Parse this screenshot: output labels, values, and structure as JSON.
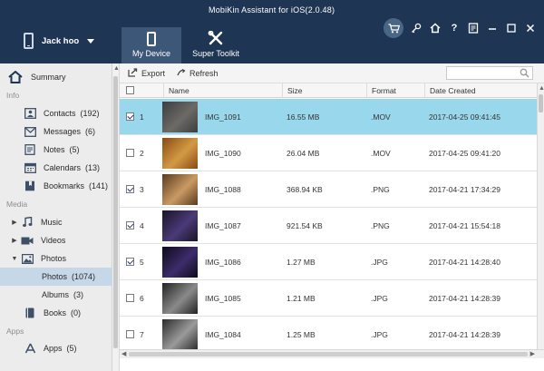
{
  "window": {
    "title": "MobiKin Assistant for iOS(2.0.48)",
    "device_name": "Jack hoo",
    "controls": [
      "cart-icon",
      "key-icon",
      "home-icon",
      "help-icon",
      "feedback-icon",
      "minimize-icon",
      "maximize-icon",
      "close-icon"
    ]
  },
  "tabs": [
    {
      "label": "My Device",
      "icon": "phone-icon",
      "active": true
    },
    {
      "label": "Super Toolkit",
      "icon": "tools-icon",
      "active": false
    }
  ],
  "sidebar": {
    "summary": {
      "label": "Summary",
      "icon": "home-icon"
    },
    "info_section": "Info",
    "info_items": [
      {
        "label": "Contacts",
        "count": "(192)",
        "icon": "contacts-icon"
      },
      {
        "label": "Messages",
        "count": "(6)",
        "icon": "messages-icon"
      },
      {
        "label": "Notes",
        "count": "(5)",
        "icon": "notes-icon"
      },
      {
        "label": "Calendars",
        "count": "(13)",
        "icon": "calendar-icon"
      },
      {
        "label": "Bookmarks",
        "count": "(141)",
        "icon": "bookmarks-icon"
      }
    ],
    "media_section": "Media",
    "media_items": [
      {
        "label": "Music",
        "icon": "music-icon",
        "expanded": false
      },
      {
        "label": "Videos",
        "icon": "video-icon",
        "expanded": false
      },
      {
        "label": "Photos",
        "icon": "photos-icon",
        "expanded": true
      }
    ],
    "photo_subitems": [
      {
        "label": "Photos",
        "count": "(1074)",
        "selected": true
      },
      {
        "label": "Albums",
        "count": "(3)",
        "selected": false
      }
    ],
    "books": {
      "label": "Books",
      "count": "(0)",
      "icon": "books-icon"
    },
    "apps_section": "Apps",
    "apps": {
      "label": "Apps",
      "count": "(5)",
      "icon": "apps-icon"
    }
  },
  "toolbar": {
    "export_label": "Export",
    "refresh_label": "Refresh",
    "search_placeholder": ""
  },
  "table": {
    "columns": [
      "Name",
      "Size",
      "Format",
      "Date Created"
    ],
    "rows": [
      {
        "index": "1",
        "checked": true,
        "selected": true,
        "name": "IMG_1091",
        "size": "16.55 MB",
        "format": ".MOV",
        "date": "2017-04-25 09:41:45",
        "thumb": [
          "#3a3d40",
          "#6d6a66"
        ]
      },
      {
        "index": "2",
        "checked": false,
        "selected": false,
        "name": "IMG_1090",
        "size": "26.04 MB",
        "format": ".MOV",
        "date": "2017-04-25 09:41:20",
        "thumb": [
          "#8a4a12",
          "#d39a45"
        ]
      },
      {
        "index": "3",
        "checked": true,
        "selected": false,
        "name": "IMG_1088",
        "size": "368.94 KB",
        "format": ".PNG",
        "date": "2017-04-21 17:34:29",
        "thumb": [
          "#5a3a20",
          "#c99a63"
        ]
      },
      {
        "index": "4",
        "checked": true,
        "selected": false,
        "name": "IMG_1087",
        "size": "921.54 KB",
        "format": ".PNG",
        "date": "2017-04-21 15:54:18",
        "thumb": [
          "#1a1426",
          "#4a3a78"
        ]
      },
      {
        "index": "5",
        "checked": true,
        "selected": false,
        "name": "IMG_1086",
        "size": "1.27 MB",
        "format": ".JPG",
        "date": "2017-04-21 14:28:40",
        "thumb": [
          "#0e0a1a",
          "#3d2c6b"
        ]
      },
      {
        "index": "6",
        "checked": false,
        "selected": false,
        "name": "IMG_1085",
        "size": "1.21 MB",
        "format": ".JPG",
        "date": "2017-04-21 14:28:39",
        "thumb": [
          "#222222",
          "#8a8a8a"
        ]
      },
      {
        "index": "7",
        "checked": false,
        "selected": false,
        "name": "IMG_1084",
        "size": "1.25 MB",
        "format": ".JPG",
        "date": "2017-04-21 14:28:39",
        "thumb": [
          "#2b2b2b",
          "#9a9a9a"
        ]
      }
    ]
  },
  "colors": {
    "titlebar": "#1e3654",
    "active_tab": "#3c5777",
    "row_selected": "#99d8ec",
    "sidebar_selected": "#c6d7e7"
  }
}
